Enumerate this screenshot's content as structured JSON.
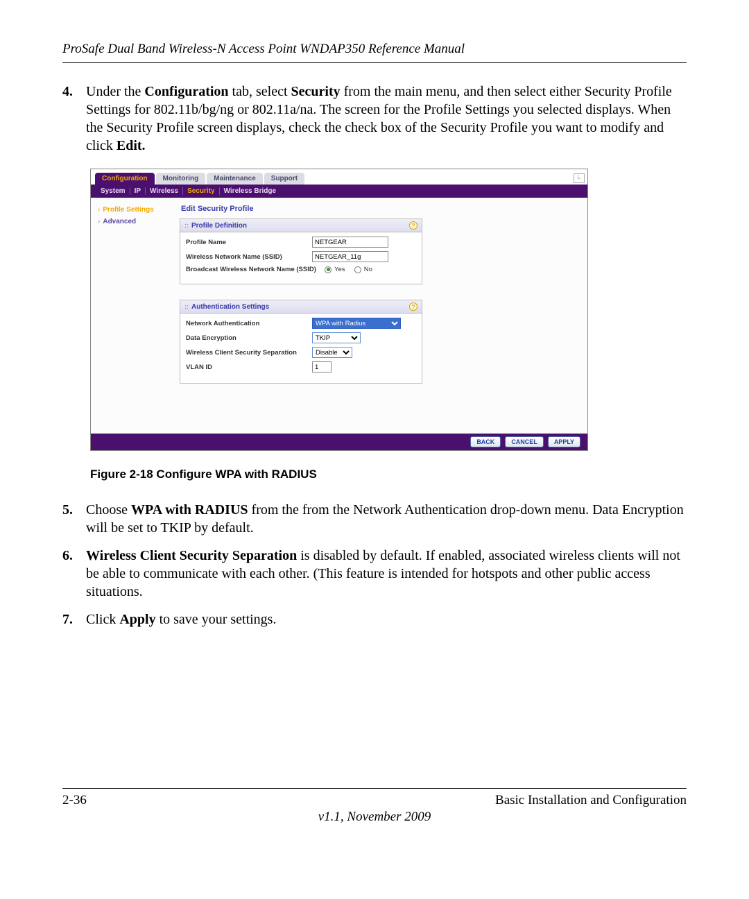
{
  "header": {
    "title": "ProSafe Dual Band Wireless-N Access Point WNDAP350 Reference Manual"
  },
  "steps": {
    "s4": {
      "num": "4.",
      "pre": "Under the ",
      "b1": "Configuration",
      "mid1": " tab, select ",
      "b2": "Security",
      "mid2": " from the main menu, and then select either Security Profile Settings for 802.11b/bg/ng or 802.11a/na. The screen for the Profile Settings you selected displays. When the Security Profile screen displays, check the check box of the Security Profile you want to modify and click ",
      "b3": "Edit.",
      "end": ""
    },
    "s5": {
      "num": "5.",
      "pre": "Choose ",
      "b1": "WPA with RADIUS",
      "post": " from the from the Network Authentication drop-down menu. Data Encryption will be set to TKIP by default."
    },
    "s6": {
      "num": "6.",
      "b1": "Wireless Client Security Separation",
      "post": " is disabled by default. If enabled, associated wireless clients will not be able to communicate with each other. (This feature is intended for hotspots and other public access situations."
    },
    "s7": {
      "num": "7.",
      "pre": "Click ",
      "b1": "Apply",
      "post": " to save your settings."
    }
  },
  "ui": {
    "tabs": {
      "configuration": "Configuration",
      "monitoring": "Monitoring",
      "maintenance": "Maintenance",
      "support": "Support"
    },
    "subnav": {
      "system": "System",
      "ip": "IP",
      "wireless": "Wireless",
      "security": "Security",
      "wireless_bridge": "Wireless Bridge"
    },
    "sidebar": {
      "profile_settings": "Profile Settings",
      "advanced": "Advanced"
    },
    "content": {
      "title": "Edit Security Profile",
      "profile_def": {
        "header": "Profile Definition",
        "name_label": "Profile Name",
        "name_value": "NETGEAR",
        "ssid_label": "Wireless Network Name (SSID)",
        "ssid_value": "NETGEAR_11g",
        "broadcast_label": "Broadcast Wireless Network Name (SSID)",
        "yes": "Yes",
        "no": "No"
      },
      "auth": {
        "header": "Authentication Settings",
        "net_auth_label": "Network Authentication",
        "net_auth_value": "WPA with Radius",
        "data_enc_label": "Data Encryption",
        "data_enc_value": "TKIP",
        "sep_label": "Wireless Client Security Separation",
        "sep_value": "Disable",
        "vlan_label": "VLAN ID",
        "vlan_value": "1"
      }
    },
    "buttons": {
      "back": "BACK",
      "cancel": "CANCEL",
      "apply": "APPLY"
    }
  },
  "caption": "Figure 2-18  Configure WPA with RADIUS",
  "footer": {
    "page": "2-36",
    "section": "Basic Installation and Configuration",
    "version": "v1.1, November 2009"
  }
}
